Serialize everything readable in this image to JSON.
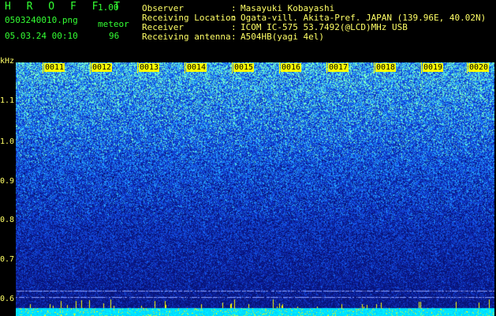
{
  "header": {
    "app_name": "H R O F F T",
    "version": "1.00",
    "filename": "0503240010.png",
    "mode": "meteor",
    "datetime": "05.03.24 00:10",
    "count": "96",
    "info": [
      {
        "label": "Observer",
        "value": "Masayuki Kobayashi"
      },
      {
        "label": "Receiving Location",
        "value": "Ogata-vill. Akita-Pref. JAPAN (139.96E, 40.02N)"
      },
      {
        "label": "Receiver",
        "value": "ICOM IC-575 53.7492(@LCD)MHz USB"
      },
      {
        "label": "Receiving antenna",
        "value": "A504HB(yagi 4el)"
      }
    ],
    "colon": ":"
  },
  "axis": {
    "unit": "kHz",
    "y_ticks": [
      "1.1",
      "1.0",
      "0.9",
      "0.8",
      "0.7",
      "0.6"
    ],
    "time_ticks": [
      "0011",
      "0012",
      "0013",
      "0014",
      "0015",
      "0016",
      "0017",
      "0018",
      "0019",
      "0020"
    ]
  },
  "colors": {
    "header_green": "#33ff33",
    "header_yellow": "#ffff66",
    "background": "#000000",
    "spectrogram_base": "#0a1a88",
    "spectrogram_noise": "#33aaff",
    "marker_yellow": "#ffff00"
  }
}
